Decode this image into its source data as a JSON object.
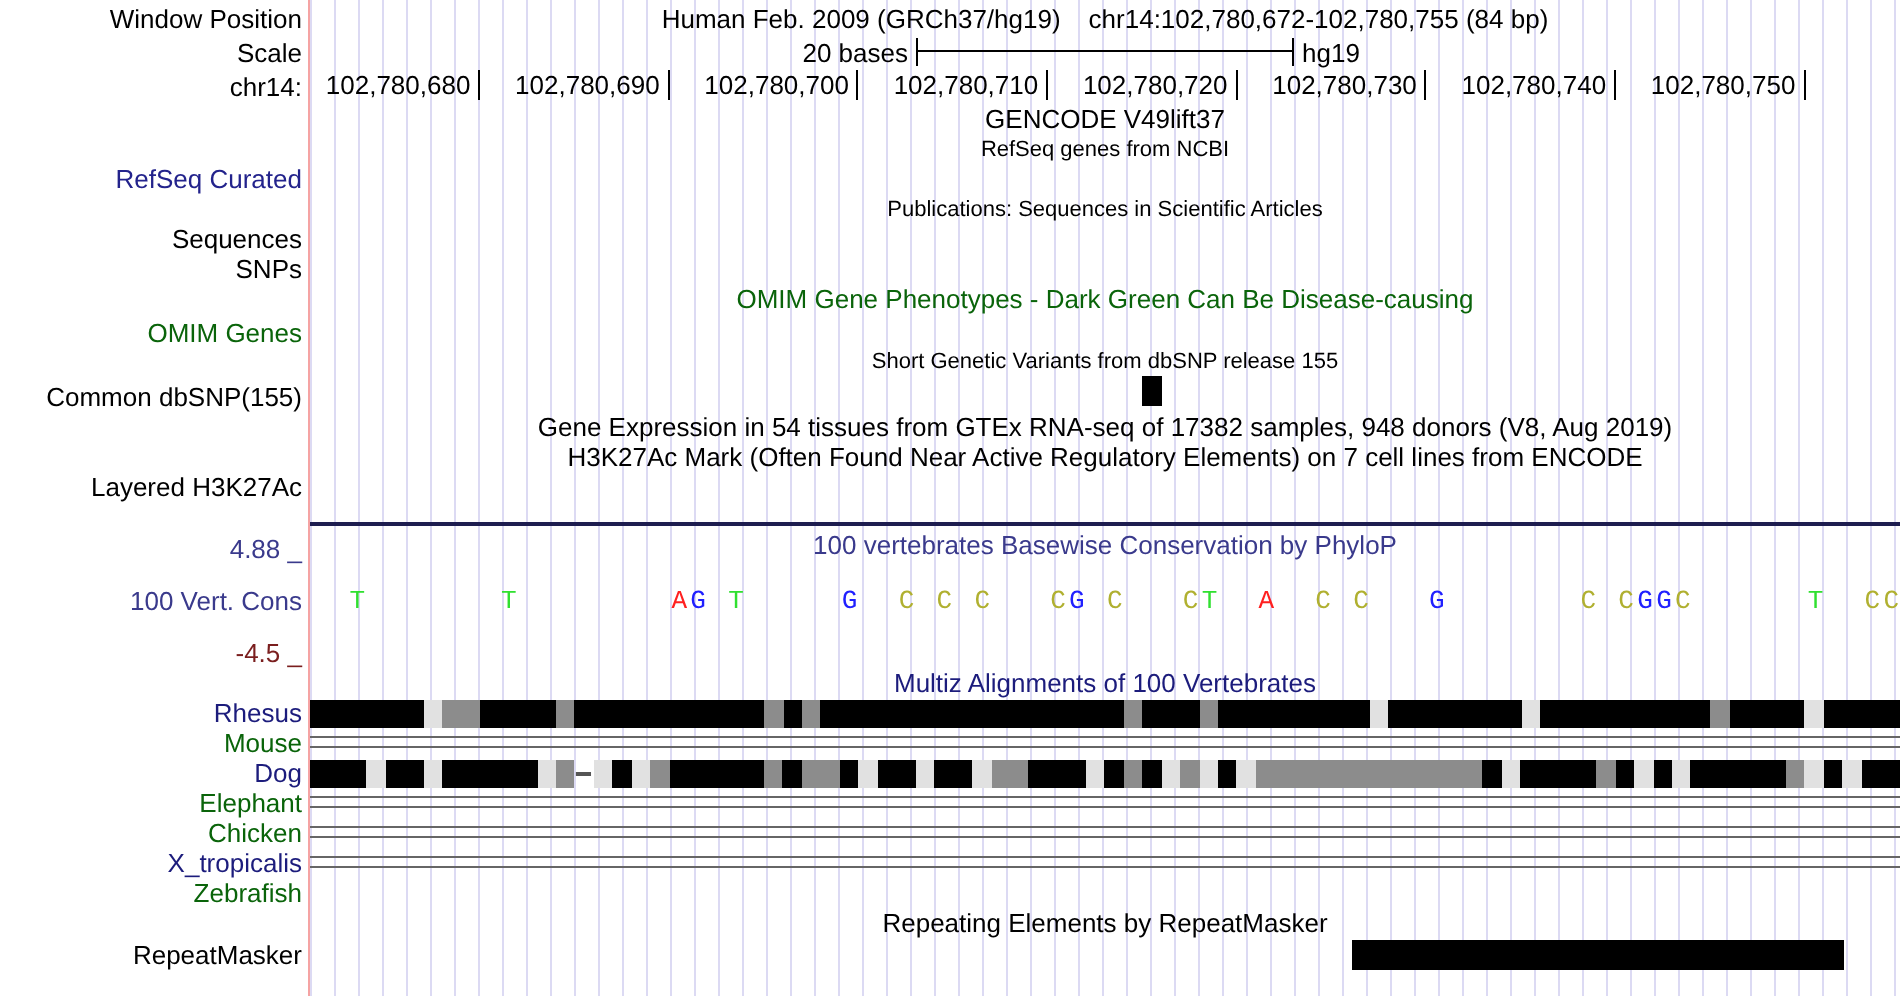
{
  "header": {
    "label": "Window Position",
    "assembly": "Human Feb. 2009 (GRCh37/hg19)",
    "position": "chr14:102,780,672-102,780,755 (84 bp)"
  },
  "scale": {
    "label": "Scale",
    "length": "20 bases",
    "assembly": "hg19"
  },
  "ruler": {
    "label": "chr14:",
    "ticks": [
      "102,780,680",
      "102,780,690",
      "102,780,700",
      "102,780,710",
      "102,780,720",
      "102,780,730",
      "102,780,740",
      "102,780,750"
    ]
  },
  "tracks": [
    {
      "kind": "title",
      "title": "GENCODE V49lift37",
      "color": "#000000"
    },
    {
      "kind": "caption",
      "title": "RefSeq genes from NCBI"
    },
    {
      "kind": "label",
      "label": "RefSeq Curated",
      "color": "#23238c"
    },
    {
      "kind": "caption",
      "title": "Publications: Sequences in Scientific Articles"
    },
    {
      "kind": "label",
      "label": "Sequences",
      "color": "#000000"
    },
    {
      "kind": "label",
      "label": "SNPs",
      "color": "#000000"
    },
    {
      "kind": "title",
      "title": "OMIM Gene Phenotypes - Dark Green Can Be Disease-causing",
      "label": "OMIM Genes",
      "color": "#0a640a"
    },
    {
      "kind": "variants",
      "title": "Short Genetic Variants from dbSNP release 155",
      "label": "Common dbSNP(155)",
      "color": "#000000"
    },
    {
      "kind": "title",
      "title": "Gene Expression in 54 tissues from GTEx RNA-seq of 17382 samples, 948 donors (V8, Aug 2019)",
      "color": "#000000"
    },
    {
      "kind": "title",
      "title": "H3K27Ac Mark (Often Found Near Active Regulatory Elements) on 7 cell lines from ENCODE",
      "color": "#000000"
    },
    {
      "kind": "label",
      "label": "Layered H3K27Ac",
      "color": "#000000"
    },
    {
      "kind": "signal"
    },
    {
      "kind": "conservation",
      "title": "100 vertebrates Basewise Conservation by PhyloP",
      "color": "#3a3a8c",
      "label": "100 Vert. Cons",
      "axis": [
        {
          "text": "4.88 _",
          "color": "#3a3a8c"
        },
        {
          "text": "-4.5 _",
          "color": "#7a1e1e"
        }
      ],
      "bases": "  T       T        AG T     G  C C C   CG C   CT  A  C C   G       C CGGC      T  CC"
    },
    {
      "kind": "title",
      "title": "Multiz Alignments of 100 Vertebrates",
      "color": "#1c1c7c"
    },
    {
      "kind": "blocks",
      "label": "Rhesus",
      "color": "#1c1c7c"
    },
    {
      "kind": "lines",
      "label": "Mouse",
      "color": "#0a640a"
    },
    {
      "kind": "blocks",
      "label": "Dog",
      "color": "#1c1c7c"
    },
    {
      "kind": "lines",
      "label": "Elephant",
      "color": "#0a640a"
    },
    {
      "kind": "lines",
      "label": "Chicken",
      "color": "#0a640a"
    },
    {
      "kind": "lines",
      "label": "X_tropicalis",
      "color": "#1c1c7c"
    },
    {
      "kind": "label",
      "label": "Zebrafish",
      "color": "#0a640a"
    },
    {
      "kind": "title",
      "title": "Repeating Elements by RepeatMasker",
      "color": "#000000"
    },
    {
      "kind": "repeats",
      "label": "RepeatMasker",
      "color": "#000000"
    }
  ]
}
